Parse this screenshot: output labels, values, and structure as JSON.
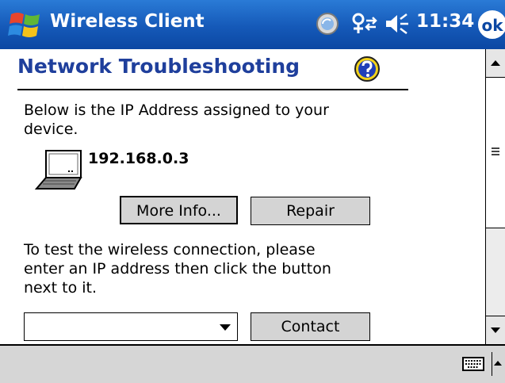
{
  "titlebar": {
    "app_title": "Wireless Client",
    "clock": "11:34",
    "ok_label": "ok"
  },
  "main": {
    "page_title": "Network Troubleshooting",
    "ip_intro": "Below is the IP Address assigned to your device.",
    "ip_address": "192.168.0.3",
    "more_info_label": "More Info...",
    "repair_label": "Repair",
    "test_intro": "To test the wireless connection, please enter an IP address then click the button next to it.",
    "ip_input_value": "",
    "contact_label": "Contact"
  },
  "icons": {
    "start": "windows-flag-icon",
    "tray_sync": "activesync-icon",
    "tray_connectivity": "connectivity-icon",
    "tray_volume": "volume-icon",
    "help": "help-icon",
    "device": "laptop-icon",
    "keyboard": "keyboard-icon"
  },
  "colors": {
    "titlebar": "#1559b8",
    "page_title": "#1f3f9c",
    "button_face": "#d4d4d4",
    "menubar": "#d6d6d6"
  }
}
